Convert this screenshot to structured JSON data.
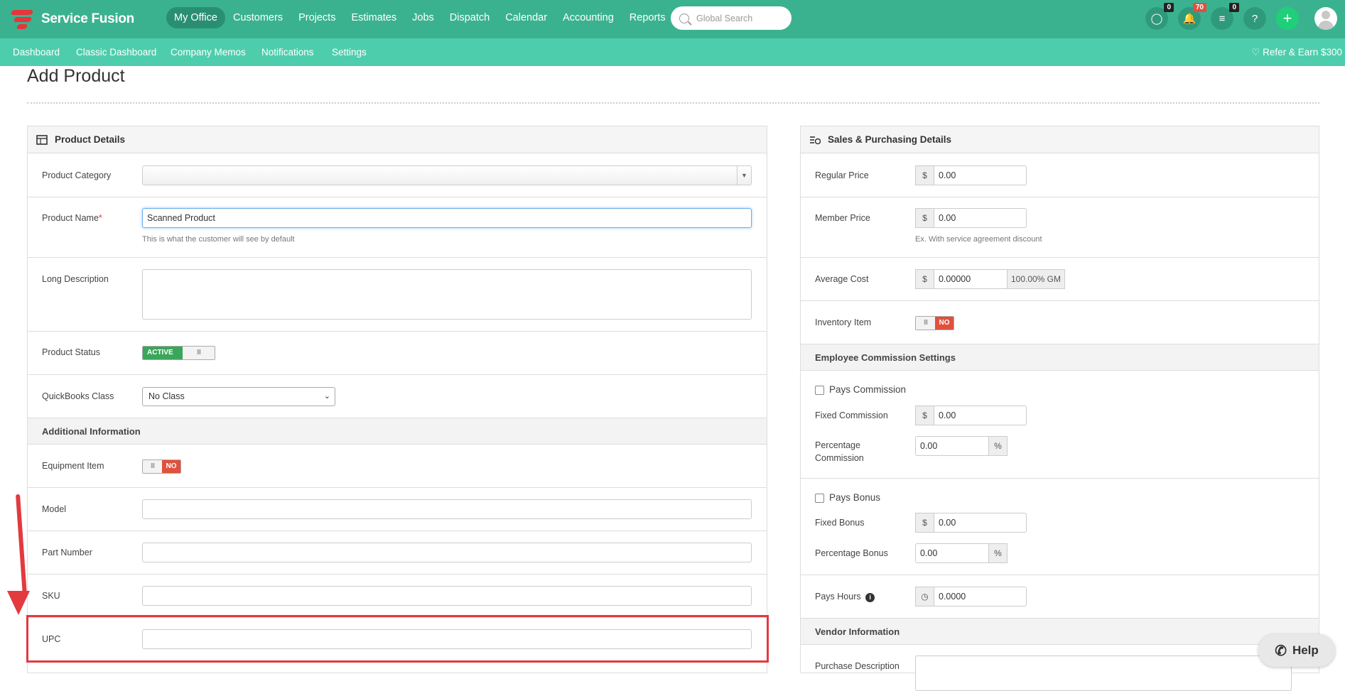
{
  "brand": {
    "name": "Service Fusion"
  },
  "nav": {
    "items": [
      "My Office",
      "Customers",
      "Projects",
      "Estimates",
      "Jobs",
      "Dispatch",
      "Calendar",
      "Accounting",
      "Reports"
    ],
    "active": "My Office"
  },
  "search": {
    "placeholder": "Global Search"
  },
  "badges": {
    "chat": "0",
    "notifications": "70",
    "tasks": "0"
  },
  "subnav": {
    "items": [
      "Dashboard",
      "Classic Dashboard",
      "Company Memos",
      "Notifications",
      "Settings"
    ],
    "refer": "Refer & Earn $300"
  },
  "page": {
    "title": "Add Product"
  },
  "product": {
    "header": "Product Details",
    "category_label": "Product Category",
    "name_label": "Product Name",
    "name_required": "*",
    "name_value": "Scanned Product",
    "name_hint": "This is what the customer will see by default",
    "long_desc_label": "Long Description",
    "status_label": "Product Status",
    "status_on": "ACTIVE",
    "status_knob": "III",
    "qb_label": "QuickBooks Class",
    "qb_value": "No Class",
    "additional_header": "Additional Information",
    "equipment_label": "Equipment Item",
    "equipment_knob": "III",
    "equipment_value": "NO",
    "model_label": "Model",
    "part_label": "Part Number",
    "sku_label": "SKU",
    "upc_label": "UPC"
  },
  "sales": {
    "header": "Sales & Purchasing Details",
    "regular_label": "Regular Price",
    "regular_value": "0.00",
    "member_label": "Member Price",
    "member_value": "0.00",
    "member_hint": "Ex. With service agreement discount",
    "avg_label": "Average Cost",
    "avg_value": "0.00000",
    "avg_gm": "100.00% GM",
    "inventory_label": "Inventory Item",
    "inventory_knob": "III",
    "inventory_value": "NO",
    "currency": "$",
    "percent": "%",
    "commission_header": "Employee Commission Settings",
    "pays_commission": "Pays Commission",
    "fixed_commission_label": "Fixed Commission",
    "fixed_commission_value": "0.00",
    "pct_commission_label_1": "Percentage",
    "pct_commission_label_2": "Commission",
    "pct_commission_value": "0.00",
    "pays_bonus": "Pays Bonus",
    "fixed_bonus_label": "Fixed Bonus",
    "fixed_bonus_value": "0.00",
    "pct_bonus_label": "Percentage Bonus",
    "pct_bonus_value": "0.00",
    "pays_hours_label": "Pays Hours",
    "pays_hours_value": "0.0000",
    "vendor_header": "Vendor Information",
    "purchase_desc_label": "Purchase Description"
  },
  "help": {
    "label": "Help"
  },
  "colors": {
    "nav": "#3bb28f",
    "subnav": "#4ecdac",
    "highlight": "#e23a3f",
    "active_toggle": "#3aa65a",
    "no_toggle": "#e0513d"
  }
}
